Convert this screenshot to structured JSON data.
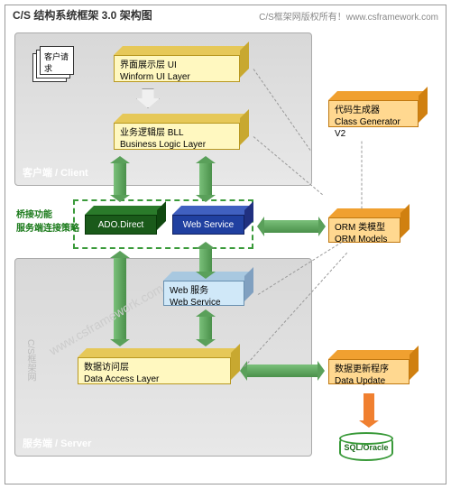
{
  "header": {
    "title": "C/S 结构系统框架 3.0 架构图",
    "copyright": "C/S框架网版权所有！www.csframework.com"
  },
  "client": {
    "panel_label": "客户端 / Client",
    "request_label": "客户请求",
    "ui_layer": {
      "cn": "界面展示层  UI",
      "en": "Winform UI Layer"
    },
    "bll_layer": {
      "cn": "业务逻辑层  BLL",
      "en": "Business Logic Layer"
    }
  },
  "generator": {
    "cn": "代码生成器",
    "en": "Class Generator V2"
  },
  "bridge": {
    "label_line1": "桥接功能",
    "label_line2": "服务端连接策略",
    "ado": "ADO.Direct",
    "ws": "Web Service"
  },
  "orm": {
    "cn": "ORM 类模型",
    "en": "ORM Models"
  },
  "server": {
    "panel_label": "服务端 / Server",
    "web_service": {
      "cn": "Web 服务",
      "en": "Web Service"
    },
    "dal": {
      "cn": "数据访问层",
      "en": "Data Access Layer"
    },
    "update": {
      "cn": "数据更新程序",
      "en": "Data Update"
    }
  },
  "db": {
    "label": "SQL/Oracle"
  },
  "watermark": {
    "url": "www.csframework.com",
    "brand": "C/S框架网"
  }
}
